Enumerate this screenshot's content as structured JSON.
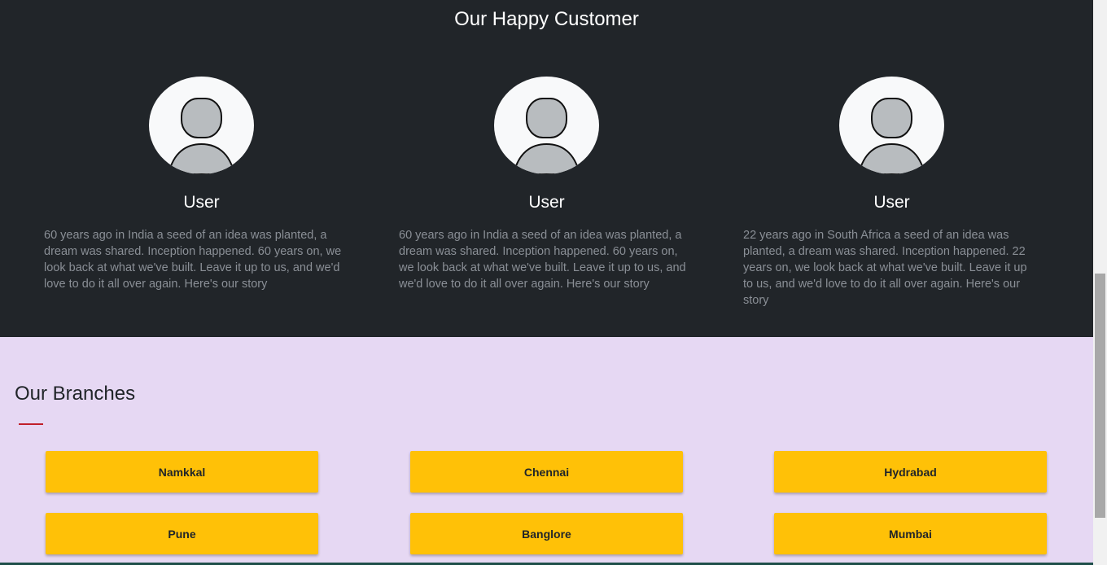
{
  "customers": {
    "title": "Our Happy Customer",
    "items": [
      {
        "name": "User",
        "avatar_icon": "user-avatar-icon",
        "text": "60 years ago in India a seed of an idea was planted, a dream was shared. Inception happened. 60 years on, we look back at what we've built. Leave it up to us, and we'd love to do it all over again. Here's our story"
      },
      {
        "name": "User",
        "avatar_icon": "user-avatar-icon",
        "text": "60 years ago in India a seed of an idea was planted, a dream was shared. Inception happened. 60 years on, we look back at what we've built. Leave it up to us, and we'd love to do it all over again. Here's our story"
      },
      {
        "name": "User",
        "avatar_icon": "user-avatar-icon",
        "text": "22 years ago in South Africa a seed of an idea was planted, a dream was shared. Inception happened. 22 years on, we look back at what we've built. Leave it up to us, and we'd love to do it all over again. Here's our story"
      }
    ]
  },
  "branches": {
    "title": "Our Branches",
    "items": [
      "Namkkal",
      "Chennai",
      "Hydrabad",
      "Pune",
      "Banglore",
      "Mumbai"
    ]
  },
  "colors": {
    "dark_section": "#212529",
    "light_section": "#e6d8f3",
    "button": "#ffc107",
    "accent_underline": "#c0202a"
  }
}
